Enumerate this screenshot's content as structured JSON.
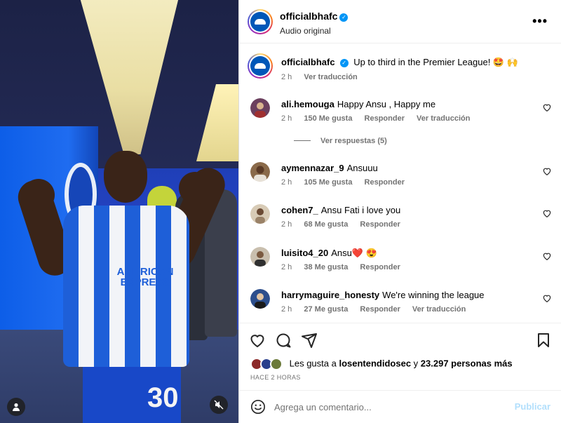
{
  "media": {
    "jersey_sponsor": "AMERICAN EXPRESS",
    "jersey_number": "30",
    "user_icon": "user-tag-icon",
    "mute_icon": "muted-speaker-icon"
  },
  "header": {
    "username": "officialbhafc",
    "subtitle": "Audio original",
    "more_icon": "more-options-icon"
  },
  "caption": {
    "username": "officialbhafc",
    "text": "Up to third in the Premier League! 🤩 🙌",
    "time": "2 h",
    "translate": "Ver traducción"
  },
  "comments": [
    {
      "username": "ali.hemouga",
      "text": "Happy Ansu , Happy me",
      "time": "2 h",
      "likes": "150 Me gusta",
      "reply": "Responder",
      "translate": "Ver traducción",
      "replies": "Ver respuestas (5)",
      "avatar_color": "#6b3f5e"
    },
    {
      "username": "aymennazar_9",
      "text": "Ansuuu",
      "time": "2 h",
      "likes": "105 Me gusta",
      "reply": "Responder",
      "translate": "",
      "replies": "",
      "avatar_color": "#8a6a4a"
    },
    {
      "username": "cohen7_",
      "text": "Ansu Fati i love you",
      "time": "2 h",
      "likes": "68 Me gusta",
      "reply": "Responder",
      "translate": "",
      "replies": "",
      "avatar_color": "#b9a58c"
    },
    {
      "username": "luisito4_20",
      "text": "Ansu❤️ 😍",
      "time": "2 h",
      "likes": "38 Me gusta",
      "reply": "Responder",
      "translate": "",
      "replies": "",
      "avatar_color": "#7b5a40"
    },
    {
      "username": "harrymaguire_honesty",
      "text": "We're winning the league",
      "time": "2 h",
      "likes": "27 Me gusta",
      "reply": "Responder",
      "translate": "Ver traducción",
      "replies": "",
      "avatar_color": "#2c4e8c"
    }
  ],
  "actions": {
    "like_icon": "heart-icon",
    "comment_icon": "comment-icon",
    "share_icon": "send-icon",
    "save_icon": "bookmark-icon"
  },
  "likes": {
    "prefix": "Les gusta a",
    "user": "losentendidosec",
    "suffix": "y",
    "count": "23.297 personas más"
  },
  "timestamp": "HACE 2 HORAS",
  "add_comment": {
    "placeholder": "Agrega un comentario...",
    "publish": "Publicar",
    "emoji_icon": "emoji-icon"
  },
  "colors": {
    "accent": "#0095f6",
    "publish_disabled": "#b2dffc",
    "club_blue": "#0057b8"
  }
}
